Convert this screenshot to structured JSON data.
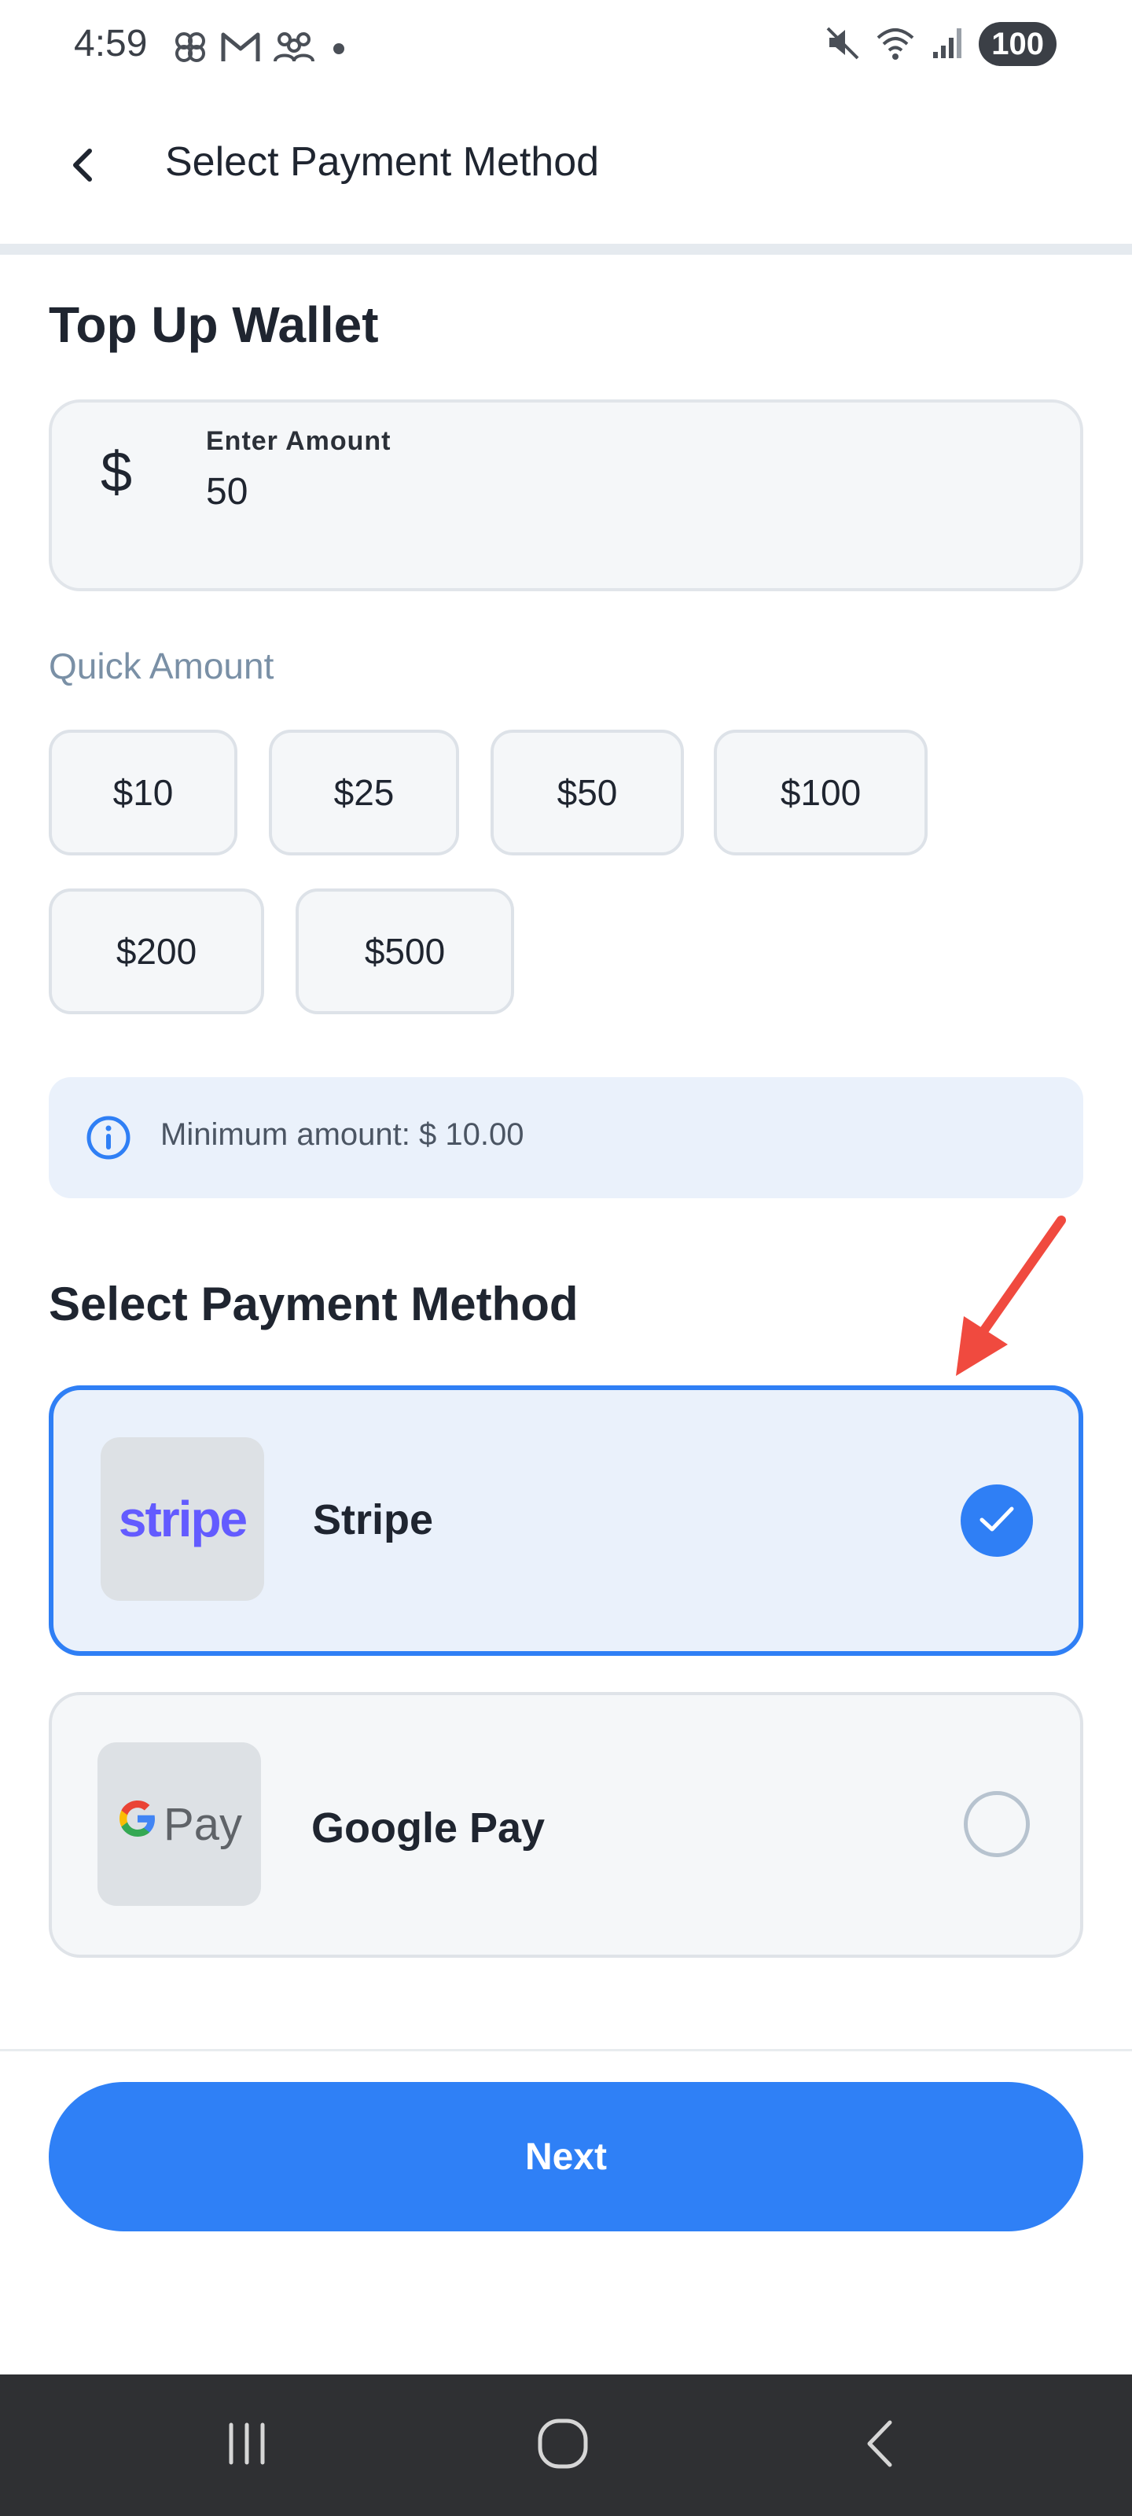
{
  "status_bar": {
    "time": "4:59",
    "battery": "100"
  },
  "app_bar": {
    "title": "Select Payment Method"
  },
  "top_up": {
    "heading": "Top Up Wallet",
    "currency_symbol": "$",
    "amount_label": "Enter Amount",
    "amount_value": "50"
  },
  "quick_amount": {
    "label": "Quick Amount",
    "options": [
      "$10",
      "$25",
      "$50",
      "$100",
      "$200",
      "$500"
    ]
  },
  "info": {
    "text": "Minimum amount: $ 10.00"
  },
  "payment": {
    "heading": "Select Payment Method",
    "methods": [
      {
        "name": "Stripe",
        "logo_text": "stripe",
        "selected": true
      },
      {
        "name": "Google Pay",
        "logo_text": "Pay",
        "selected": false
      }
    ]
  },
  "footer": {
    "next_label": "Next"
  },
  "colors": {
    "accent": "#2f7ff5",
    "selected_bg": "#eaf1fb",
    "stripe_brand": "#635bff",
    "annotation_arrow": "#f04a3f"
  },
  "icons": [
    "pinwheel-icon",
    "gmail-icon",
    "people-icon",
    "dot-icon",
    "mute-icon",
    "wifi-icon",
    "signal-icon",
    "back-arrow-icon",
    "info-icon",
    "checkmark-icon",
    "google-g-icon",
    "recents-icon",
    "home-icon",
    "nav-back-icon"
  ]
}
